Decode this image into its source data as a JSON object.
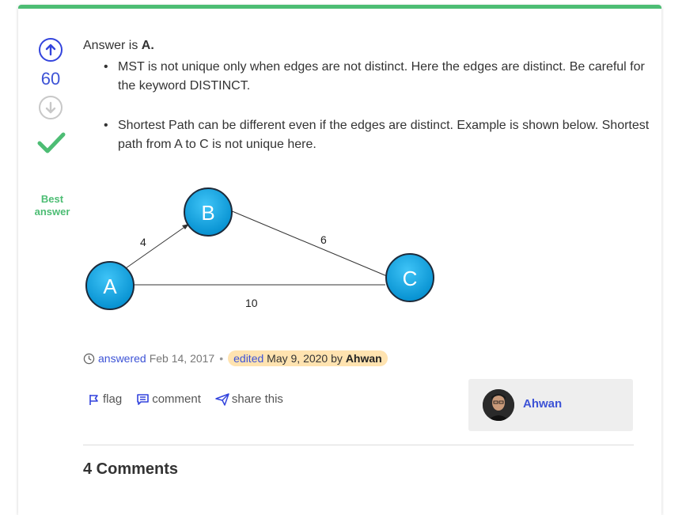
{
  "vote": {
    "count": "60",
    "up_icon": "arrow-up-circle-icon",
    "down_icon": "arrow-down-circle-icon",
    "best_icon": "checkmark-icon",
    "best_label_line1": "Best",
    "best_label_line2": "answer"
  },
  "answer": {
    "intro_prefix": "Answer is ",
    "intro_answer": "A.",
    "points": [
      "MST is not unique only when edges are not distinct. Here the edges are distinct. Be careful for the keyword DISTINCT.",
      "Shortest Path can be different even if the edges are distinct. Example is shown below. Shortest path from A to C is not unique here."
    ],
    "graph": {
      "nodes": [
        "A",
        "B",
        "C"
      ],
      "edges": [
        {
          "from": "A",
          "to": "B",
          "weight": "4"
        },
        {
          "from": "B",
          "to": "C",
          "weight": "6"
        },
        {
          "from": "A",
          "to": "C",
          "weight": "10"
        }
      ],
      "node_color": "#0aa6e6"
    }
  },
  "meta": {
    "answered_label": "answered",
    "answered_date": "Feb 14, 2017",
    "separator": "•",
    "edited_label": "edited",
    "edited_date": "May 9, 2020",
    "by_label": "by",
    "editor": "Ahwan"
  },
  "actions": {
    "flag": "flag",
    "comment": "comment",
    "share": "share this"
  },
  "user": {
    "name": "Ahwan"
  },
  "comments": {
    "title": "4 Comments"
  },
  "colors": {
    "accent": "#3d53d6",
    "best": "#4dbd74",
    "edited_bg": "#ffe3b0"
  }
}
